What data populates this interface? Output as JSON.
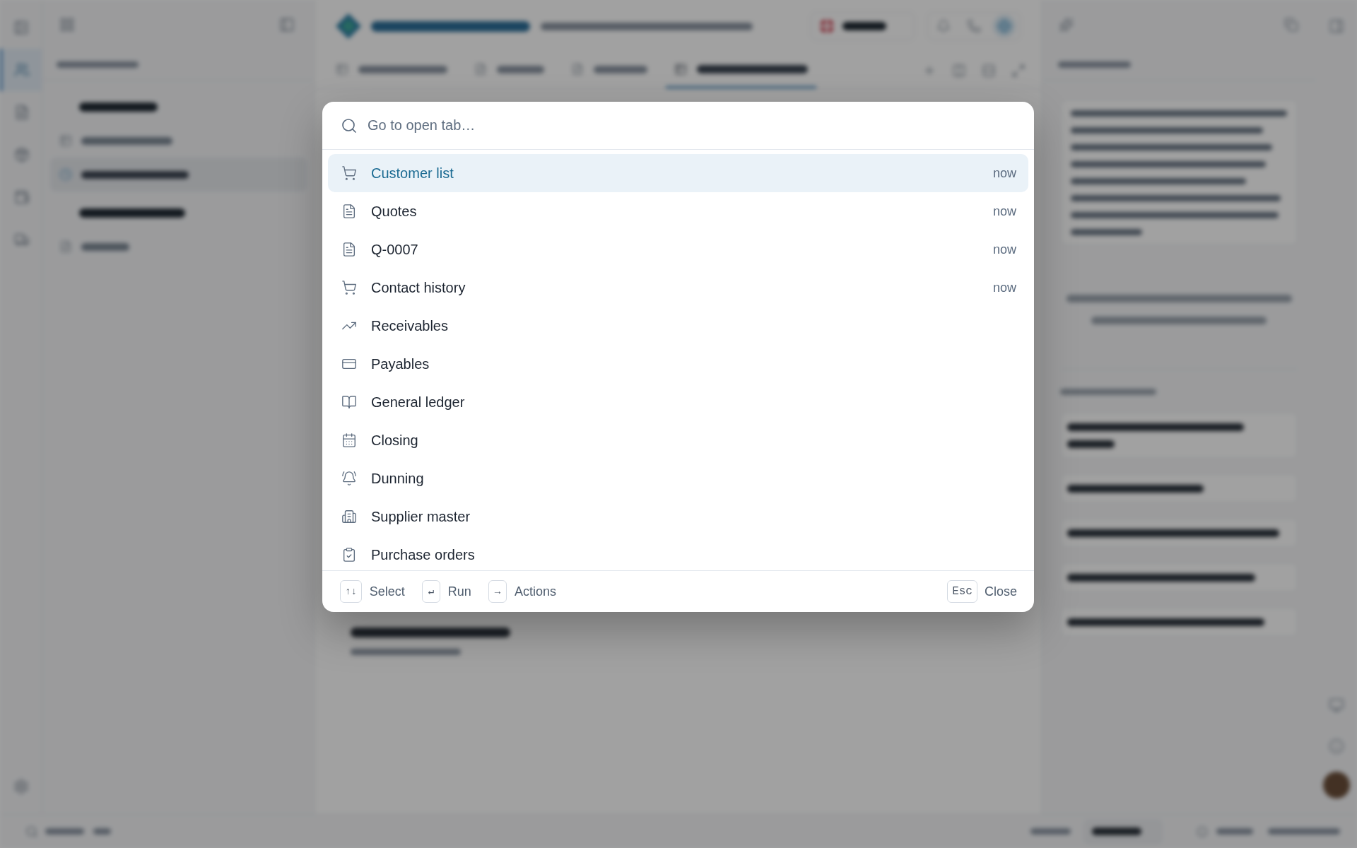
{
  "background_app": {
    "rail": [
      {
        "selected": true
      },
      {
        "selected": false
      },
      {
        "selected": false
      },
      {
        "selected": false
      },
      {
        "selected": false
      }
    ],
    "sidebar_rows": [
      {
        "kind": "group"
      },
      {
        "kind": "table",
        "selected": false
      },
      {
        "kind": "clock",
        "selected": true
      },
      {
        "kind": "group"
      },
      {
        "kind": "document",
        "selected": false
      }
    ],
    "tabs": [
      {
        "kind": "table",
        "selected": false
      },
      {
        "kind": "document",
        "selected": false
      },
      {
        "kind": "document",
        "selected": false
      },
      {
        "kind": "table",
        "selected": true
      }
    ]
  },
  "command_palette": {
    "search": {
      "placeholder": "Go to open tab…"
    },
    "items": [
      {
        "label": "Customer list",
        "kind": "cart",
        "time": "now",
        "selected": true
      },
      {
        "label": "Quotes",
        "kind": "document",
        "time": "now",
        "selected": false
      },
      {
        "label": "Q-0007",
        "kind": "document",
        "time": "now",
        "selected": false
      },
      {
        "label": "Contact history",
        "kind": "cart",
        "time": "now",
        "selected": false
      },
      {
        "label": "Receivables",
        "kind": "trend",
        "selected": false
      },
      {
        "label": "Payables",
        "kind": "card",
        "selected": false
      },
      {
        "label": "General ledger",
        "kind": "book",
        "selected": false
      },
      {
        "label": "Closing",
        "kind": "calendar",
        "selected": false
      },
      {
        "label": "Dunning",
        "kind": "bell",
        "selected": false
      },
      {
        "label": "Supplier master",
        "kind": "building",
        "selected": false
      },
      {
        "label": "Purchase orders",
        "kind": "clipboard",
        "selected": false
      }
    ],
    "hints": [
      {
        "key": "↑↓",
        "label": "Select"
      },
      {
        "key": "↵",
        "label": "Run"
      },
      {
        "key": "→",
        "label": "Actions"
      }
    ],
    "close": {
      "key": "Esc",
      "label": "Close"
    }
  }
}
